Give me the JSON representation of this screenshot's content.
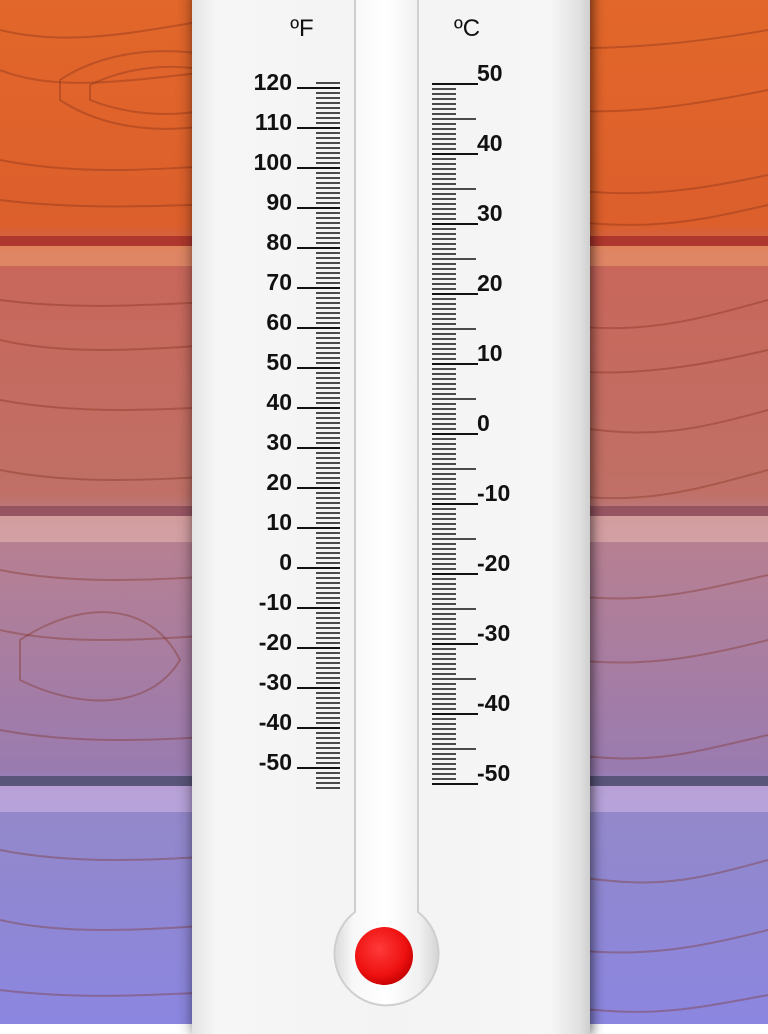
{
  "colors": {
    "wood_top": "#e2672a",
    "wood_upper": "#c9665a",
    "wood_middle": "#a07aa8",
    "wood_bottom": "#8b86e0",
    "panel": "#f3f3f3",
    "bulb": "#ee1111",
    "ink": "#111111"
  },
  "fahrenheit": {
    "unit_label": "ºF",
    "labels": [
      "120",
      "110",
      "100",
      "90",
      "80",
      "70",
      "60",
      "50",
      "40",
      "30",
      "20",
      "10",
      "0",
      "-10",
      "-20",
      "-30",
      "-40",
      "-50"
    ]
  },
  "celsius": {
    "unit_label": "ºC",
    "labels": [
      "50",
      "40",
      "30",
      "20",
      "10",
      "0",
      "-10",
      "-20",
      "-30",
      "-40",
      "-50"
    ]
  },
  "bulb": {
    "icon": "mercury-bulb-icon"
  }
}
